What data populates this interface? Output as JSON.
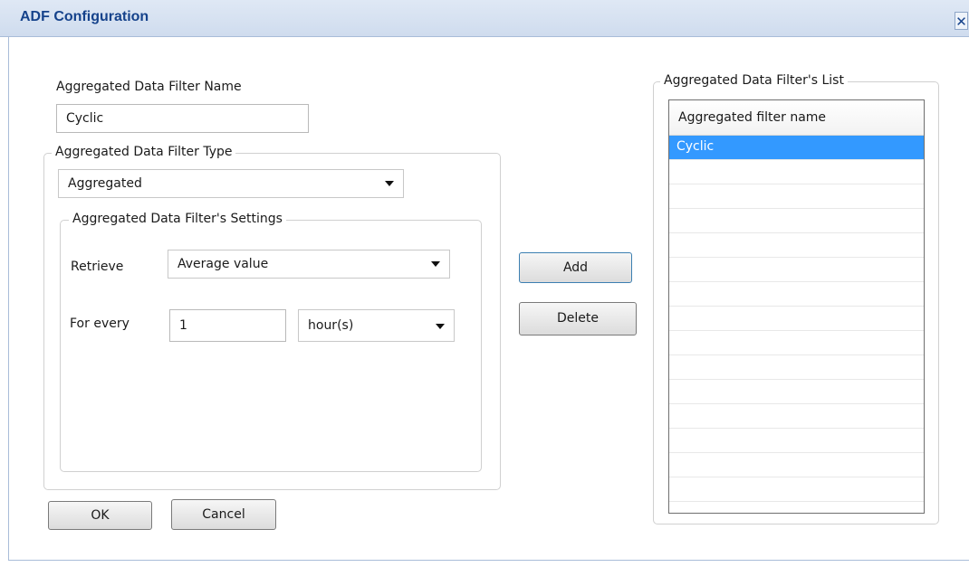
{
  "window": {
    "title": "ADF Configuration",
    "close_glyph": "✕"
  },
  "filter_name": {
    "label": "Aggregated Data Filter Name",
    "value": "Cyclic"
  },
  "filter_type": {
    "legend": "Aggregated Data Filter Type",
    "selected": "Aggregated"
  },
  "settings": {
    "legend": "Aggregated Data Filter's Settings",
    "retrieve_label": "Retrieve",
    "retrieve_selected": "Average value",
    "for_every_label": "For every",
    "for_every_value": "1",
    "unit_selected": "hour(s)"
  },
  "actions": {
    "add_label": "Add",
    "delete_label": "Delete"
  },
  "footer": {
    "ok_label": "OK",
    "cancel_label": "Cancel"
  },
  "list": {
    "legend": "Aggregated Data Filter's List",
    "column_header": "Aggregated filter name",
    "rows": [
      "Cyclic",
      "",
      "",
      "",
      "",
      "",
      "",
      "",
      "",
      "",
      "",
      "",
      "",
      "",
      "",
      ""
    ],
    "selected_row": 0
  },
  "colors": {
    "accent": "#15428b",
    "selection": "#3399ff"
  },
  "icons": {
    "close": "close-icon",
    "dropdown": "chevron-down-icon"
  }
}
